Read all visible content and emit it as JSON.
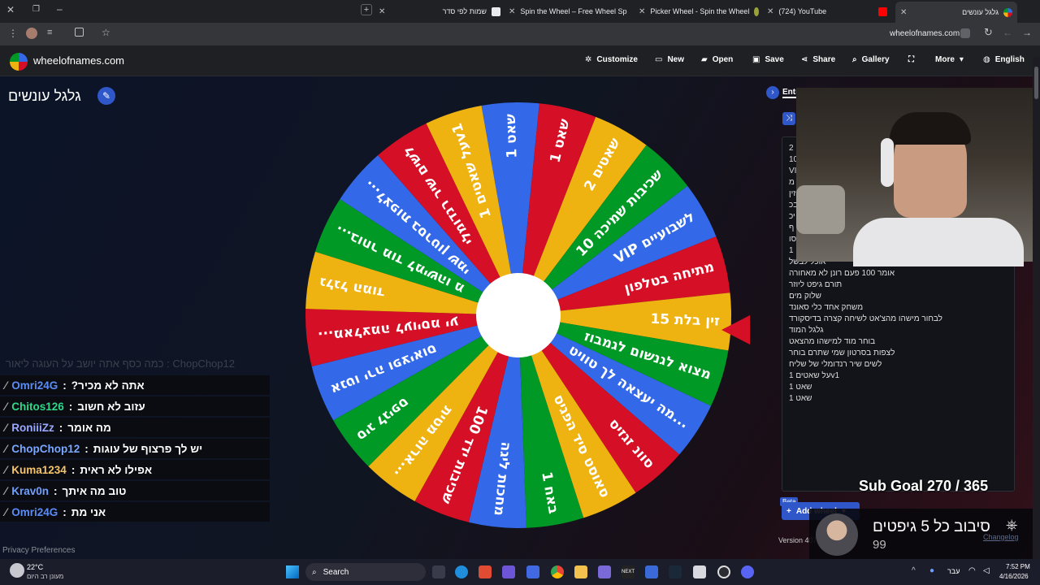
{
  "browser": {
    "tabs": [
      {
        "label": "שמות לפי סדר",
        "favicon_color": "#e8eaed"
      },
      {
        "label": "Spin the Wheel – Free Wheel Sp",
        "favicon_color": "#e14f9b"
      },
      {
        "label": "Picker Wheel - Spin the Wheel",
        "favicon_color": "#9aa33b"
      },
      {
        "label": "(724) YouTube",
        "favicon_color": "#ff0000"
      },
      {
        "label": "גלגל עונשים",
        "favicon_color": "#3369e8"
      }
    ],
    "url": "wheelofnames.com"
  },
  "site": {
    "logo_text": "wheelofnames.com",
    "nav": {
      "customize": "Customize",
      "new": "New",
      "open": "Open",
      "save": "Save",
      "share": "Share",
      "gallery": "Gallery",
      "more": "More",
      "language": "English"
    },
    "wheel_title": "גלגל עונשים",
    "entries_tab": "Entr",
    "add_wheel": "Add wheel",
    "beta": "Beta",
    "version": "Version 407",
    "privacy": "Privacy Preferences"
  },
  "wheel": {
    "colors": [
      "#3369e8",
      "#d50f25",
      "#eeb211",
      "#009925"
    ],
    "slices": [
      "1 שאט",
      "1 שאט",
      "2 שאטים",
      "שכיבות שמיכה 10",
      "VIP לשבועיים",
      "מתיחה בטלפון",
      "זין בלת 15",
      "מצוא לגנשום לגמבוז",
      "מה יעצאה לך טוויט...",
      "סוונ זגזיס",
      "סאוסט סיד הפגיס",
      "1 באח",
      "מחכות ליגה",
      "100 שכיבות ידד",
      "ארוה מטית...",
      "סיג לגיפס",
      "אנטו ירה ופציאוס",
      "מאלצמה לעויסמ יע...",
      "גלגל המוד",
      "בוחר מוד למישהו מ...",
      "לצפות בסרטון שמי...",
      "לשים שיר רנדומלי",
      "על שאטים 1v1"
    ]
  },
  "entries": [
    "2",
    "10",
    "VI",
    "מ",
    "זין",
    "בכ",
    "יכ",
    "ף",
    "סו",
    "1",
    "אוכל לבשל",
    "אומר 100 פעם רונן לא מאחורה",
    "תורם גיפט ליוזר",
    "שלוק מים",
    "משחק אחד כלי סאונד",
    "לבחור מישהו מהצ'אט לשיחה קצרה בדיסקורד",
    "גלגל המוד",
    "בוחר מוד למישהו מהצאט",
    "לצפות בסרטון שמי שתרם בוחר",
    "לשים שיר רנדומלי של שליח",
    "על שאטים 1v1",
    "שאט 1",
    "שאט 1"
  ],
  "chat": {
    "faded_line": "כמה כסף אתה יושב על העוגה ליאור : ChopChop12",
    "messages": [
      {
        "user": "Omri24G",
        "color": "#5b8cf5",
        "text": "אתה לא מכיר?"
      },
      {
        "user": "Chitos126",
        "color": "#2fd88a",
        "text": "עזוב לא חשוב"
      },
      {
        "user": "RoniiiZz",
        "color": "#9aa8ff",
        "text": "מה אומר"
      },
      {
        "user": "ChopChop12",
        "color": "#7aa7ff",
        "text": "יש לך פרצוף של עוגות"
      },
      {
        "user": "Kuma1234",
        "color": "#f5c46b",
        "text": "אפילו לא ראית"
      },
      {
        "user": "Krav0n",
        "color": "#6fa0ff",
        "text": "טוב מה איתך"
      },
      {
        "user": "Omri24G",
        "color": "#5b8cf5",
        "text": "אני מת"
      }
    ]
  },
  "stream": {
    "sub_goal": "Sub Goal 270 / 365",
    "gift_text": "סיבוב כל 5 גיפטים",
    "gift_count": "99",
    "changelog": "Changelog"
  },
  "taskbar": {
    "weather_temp": "22°C",
    "weather_desc": "מעונן רב היום",
    "search": "Search",
    "lang": "עבר",
    "time": "7:52 PM",
    "date": "4/16/2026"
  }
}
